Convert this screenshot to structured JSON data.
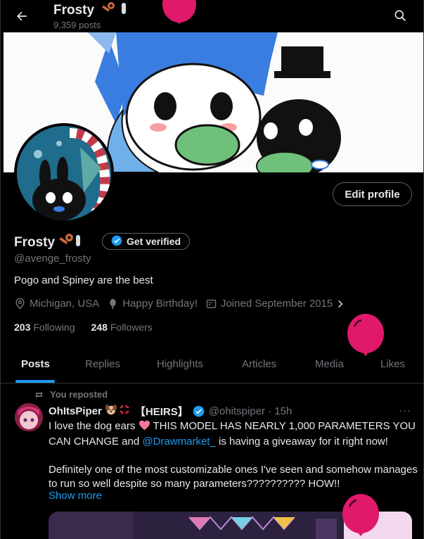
{
  "header": {
    "display_name": "Frosty",
    "posts_count": "9,359 posts"
  },
  "profile": {
    "display_name": "Frosty",
    "handle": "@avenge_frosty",
    "bio": "Pogo and Spiney are the best",
    "edit_profile_label": "Edit profile",
    "get_verified_label": "Get verified",
    "location": "Michigan, USA",
    "birthday": "Happy Birthday!",
    "joined": "Joined September 2015",
    "following_count": "203",
    "following_label": "Following",
    "followers_count": "248",
    "followers_label": "Followers"
  },
  "tabs": [
    {
      "label": "Posts"
    },
    {
      "label": "Replies"
    },
    {
      "label": "Highlights"
    },
    {
      "label": "Articles"
    },
    {
      "label": "Media"
    },
    {
      "label": "Likes"
    }
  ],
  "post": {
    "repost_label": "You reposted",
    "display_name": "OhItsPiper",
    "name_suffix": "【HEIRS】",
    "handle_time": "@ohitspiper · 15h",
    "more": "···",
    "text_1": "I love the dog ears",
    "text_2": "THIS MODEL HAS NEARLY 1,000 PARAMETERS YOU CAN CHANGE and",
    "mention": "@Drawmarket_",
    "text_3": "is having a giveaway for it right now!",
    "text_4": "Definitely one of the most customizable ones I've seen and somehow manages to run so well despite so many parameters?????????? HOW!!",
    "show_more": "Show more"
  },
  "colors": {
    "accent": "#1d9bf0",
    "balloon": "#e0196b",
    "muted": "#71767b",
    "text": "#e7e9ea"
  }
}
